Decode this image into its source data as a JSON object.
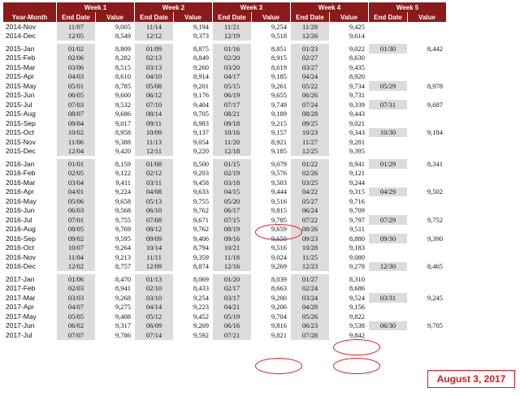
{
  "header": {
    "year_month": "Year-Month",
    "weeks": [
      "Week 1",
      "Week 2",
      "Week 3",
      "Week 4",
      "Week 5"
    ],
    "end_date": "End Date",
    "value": "Value"
  },
  "groups": [
    [
      [
        "2014-Nov",
        "11/07",
        "9,005",
        "11/14",
        "9,194",
        "11/21",
        "9,254",
        "11/28",
        "9,425",
        "",
        ""
      ],
      [
        "2014-Dec",
        "12/05",
        "8,549",
        "12/12",
        "9,373",
        "12/19",
        "9,518",
        "12/26",
        "9,614",
        "",
        ""
      ]
    ],
    [
      [
        "2015-Jan",
        "01/02",
        "8,809",
        "01/09",
        "8,875",
        "01/16",
        "8,851",
        "01/23",
        "9,022",
        "01/30",
        "8,442"
      ],
      [
        "2015-Feb",
        "02/06",
        "8,282",
        "02/13",
        "8,849",
        "02/20",
        "8,915",
        "02/27",
        "8,630",
        "",
        ""
      ],
      [
        "2015-Mar",
        "03/06",
        "8,515",
        "03/13",
        "9,260",
        "03/20",
        "8,619",
        "03/27",
        "9,435",
        "",
        ""
      ],
      [
        "2015-Apr",
        "04/03",
        "8,610",
        "04/10",
        "8,914",
        "04/17",
        "9,185",
        "04/24",
        "8,920",
        "",
        ""
      ],
      [
        "2015-May",
        "05/01",
        "8,785",
        "05/08",
        "9,201",
        "05/15",
        "9,261",
        "05/22",
        "9,734",
        "05/29",
        "8,978"
      ],
      [
        "2015-Jun",
        "06/05",
        "9,600",
        "06/12",
        "9,176",
        "06/19",
        "9,655",
        "06/26",
        "9,731",
        "",
        ""
      ],
      [
        "2015-Jul",
        "07/03",
        "9,532",
        "07/10",
        "9,404",
        "07/17",
        "9,749",
        "07/24",
        "9,339",
        "07/31",
        "9,687"
      ],
      [
        "2015-Aug",
        "08/07",
        "9,686",
        "08/14",
        "9,705",
        "08/21",
        "9,189",
        "08/28",
        "9,443",
        "",
        ""
      ],
      [
        "2015-Sep",
        "09/04",
        "9,017",
        "09/11",
        "8,983",
        "09/18",
        "9,215",
        "09/25",
        "9,021",
        "",
        ""
      ],
      [
        "2015-Oct",
        "10/02",
        "8,958",
        "10/09",
        "9,137",
        "10/16",
        "9,157",
        "10/23",
        "9,343",
        "10/30",
        "9,184"
      ],
      [
        "2015-Nov",
        "11/06",
        "9,388",
        "11/13",
        "9,054",
        "11/20",
        "8,921",
        "11/27",
        "9,281",
        "",
        ""
      ],
      [
        "2015-Dec",
        "12/04",
        "9,420",
        "12/11",
        "9,220",
        "12/18",
        "9,185",
        "12/25",
        "9,395",
        "",
        ""
      ]
    ],
    [
      [
        "2016-Jan",
        "01/01",
        "8,159",
        "01/08",
        "8,500",
        "01/15",
        "9,079",
        "01/22",
        "8,941",
        "01/29",
        "8,341"
      ],
      [
        "2016-Feb",
        "02/05",
        "9,122",
        "02/12",
        "9,203",
        "02/19",
        "9,576",
        "02/26",
        "9,121",
        "",
        ""
      ],
      [
        "2016-Mar",
        "03/04",
        "9,411",
        "03/11",
        "9,458",
        "03/18",
        "9,503",
        "03/25",
        "9,244",
        "",
        ""
      ],
      [
        "2016-Apr",
        "04/01",
        "9,224",
        "04/08",
        "9,633",
        "04/15",
        "9,444",
        "04/22",
        "9,315",
        "04/29",
        "9,502"
      ],
      [
        "2016-May",
        "05/06",
        "9,658",
        "05/13",
        "9,755",
        "05/20",
        "9,516",
        "05/27",
        "9,716",
        "",
        ""
      ],
      [
        "2016-Jun",
        "06/03",
        "9,568",
        "06/10",
        "9,762",
        "06/17",
        "9,815",
        "06/24",
        "9,709",
        "",
        ""
      ],
      [
        "2016-Jul",
        "07/01",
        "9,755",
        "07/08",
        "9,671",
        "07/15",
        "9,785",
        "07/22",
        "9,797",
        "07/29",
        "9,752"
      ],
      [
        "2016-Aug",
        "08/05",
        "9,769",
        "08/12",
        "9,762",
        "08/19",
        "9,659",
        "08/26",
        "9,511",
        "",
        ""
      ],
      [
        "2016-Sep",
        "09/02",
        "9,595",
        "09/09",
        "9,406",
        "09/16",
        "9,650",
        "09/23",
        "8,880",
        "09/30",
        "9,390"
      ],
      [
        "2016-Oct",
        "10/07",
        "9,264",
        "10/14",
        "8,794",
        "10/21",
        "9,516",
        "10/28",
        "9,183",
        "",
        ""
      ],
      [
        "2016-Nov",
        "11/04",
        "9,213",
        "11/11",
        "9,359",
        "11/18",
        "9,024",
        "11/25",
        "9,080",
        "",
        ""
      ],
      [
        "2016-Dec",
        "12/02",
        "8,757",
        "12/09",
        "8,874",
        "12/16",
        "9,269",
        "12/23",
        "9,278",
        "12/30",
        "8,465"
      ]
    ],
    [
      [
        "2017-Jan",
        "01/06",
        "8,470",
        "01/13",
        "8,069",
        "01/20",
        "8,039",
        "01/27",
        "8,310",
        "",
        ""
      ],
      [
        "2017-Feb",
        "02/03",
        "8,941",
        "02/10",
        "8,433",
        "02/17",
        "8,663",
        "02/24",
        "8,686",
        "",
        ""
      ],
      [
        "2017-Mar",
        "03/03",
        "9,268",
        "03/10",
        "9,254",
        "03/17",
        "9,200",
        "03/24",
        "9,524",
        "03/31",
        "9,245"
      ],
      [
        "2017-Apr",
        "04/07",
        "9,275",
        "04/14",
        "9,223",
        "04/21",
        "9,206",
        "04/28",
        "9,156",
        "",
        ""
      ],
      [
        "2017-May",
        "05/05",
        "9,408",
        "05/12",
        "9,452",
        "05/19",
        "9,704",
        "05/26",
        "9,822",
        "",
        ""
      ],
      [
        "2017-Jun",
        "06/02",
        "9,317",
        "06/09",
        "9,269",
        "06/16",
        "9,816",
        "06/23",
        "9,538",
        "06/30",
        "9,705"
      ],
      [
        "2017-Jul",
        "07/07",
        "9,786",
        "07/14",
        "9,592",
        "07/21",
        "9,821",
        "07/28",
        "9,842",
        "",
        ""
      ]
    ]
  ],
  "date_label": "August 3, 2017"
}
